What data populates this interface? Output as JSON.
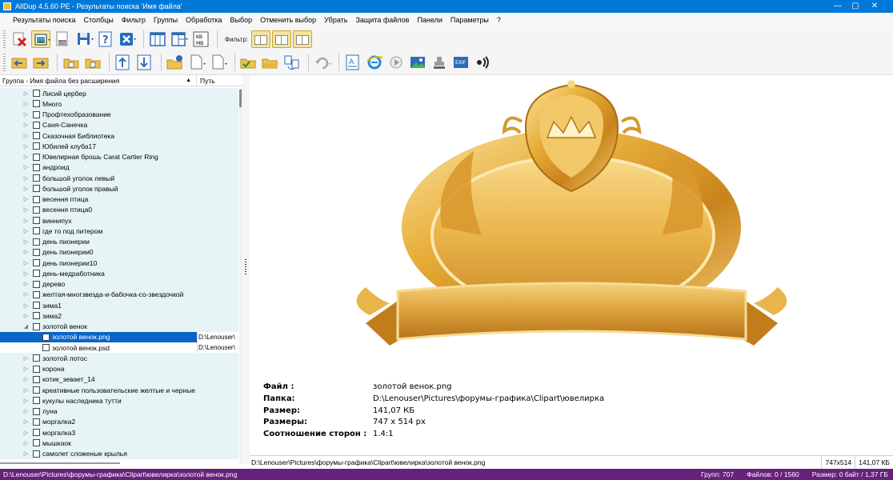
{
  "window": {
    "title": "AllDup 4.5.60 PE - Результаты поиска 'Имя файла'",
    "controls": [
      "—",
      "▢",
      "✕"
    ]
  },
  "menu": [
    "Результаты поиска",
    "Столбцы",
    "Фильтр",
    "Группы",
    "Обработка",
    "Выбор",
    "Отменить выбор",
    "Убрать",
    "Защита файлов",
    "Панели",
    "Параметры",
    "?"
  ],
  "toolbar": {
    "filter_label": "Фильтр:",
    "kbmb": "KB MB"
  },
  "left_pane": {
    "col_group": "Группа - Имя файла без расширения",
    "col_path": "Путь",
    "sort_icon": "▲",
    "rows": [
      {
        "label": "Лисий цербер",
        "type": "group",
        "expanded": false
      },
      {
        "label": "Много",
        "type": "group",
        "expanded": false
      },
      {
        "label": "Профтехобразование",
        "type": "group",
        "expanded": false
      },
      {
        "label": "Саня-Санечка",
        "type": "group",
        "expanded": false
      },
      {
        "label": "Сказочная Библиотека",
        "type": "group",
        "expanded": false
      },
      {
        "label": "Юбилей клуба17",
        "type": "group",
        "expanded": false
      },
      {
        "label": "Ювелирная брошь Carat Cartier Ring",
        "type": "group",
        "expanded": false
      },
      {
        "label": "андроид",
        "type": "group",
        "expanded": false
      },
      {
        "label": "большой уголок левый",
        "type": "group",
        "expanded": false
      },
      {
        "label": "большой уголок правый",
        "type": "group",
        "expanded": false
      },
      {
        "label": "весення птица",
        "type": "group",
        "expanded": false
      },
      {
        "label": "весення птица0",
        "type": "group",
        "expanded": false
      },
      {
        "label": "виннипух",
        "type": "group",
        "expanded": false
      },
      {
        "label": "где то под питером",
        "type": "group",
        "expanded": false
      },
      {
        "label": "день пионерии",
        "type": "group",
        "expanded": false
      },
      {
        "label": "день пионерии0",
        "type": "group",
        "expanded": false
      },
      {
        "label": "день пионерии10",
        "type": "group",
        "expanded": false
      },
      {
        "label": "день-медработника",
        "type": "group",
        "expanded": false
      },
      {
        "label": "дерево",
        "type": "group",
        "expanded": false
      },
      {
        "label": "желтая-многзвезда-и-бабочка-со-звездочкой",
        "type": "group",
        "expanded": false
      },
      {
        "label": "зима1",
        "type": "group",
        "expanded": false
      },
      {
        "label": "зима2",
        "type": "group",
        "expanded": false
      },
      {
        "label": "золотой венок",
        "type": "group",
        "expanded": true
      },
      {
        "label": "золотой венок.png",
        "type": "file",
        "path": "D:\\Lenouser\\",
        "selected": true
      },
      {
        "label": "золотой венок.psd",
        "type": "file",
        "path": "D:\\Lenouser\\",
        "selected": false
      },
      {
        "label": "золотой лотос",
        "type": "group",
        "expanded": false
      },
      {
        "label": "корона",
        "type": "group",
        "expanded": false
      },
      {
        "label": "котик_зевает_14",
        "type": "group",
        "expanded": false
      },
      {
        "label": "креативные пользовательские желтые и черные",
        "type": "group",
        "expanded": false
      },
      {
        "label": "кукулы наследника тутти",
        "type": "group",
        "expanded": false
      },
      {
        "label": "луна",
        "type": "group",
        "expanded": false
      },
      {
        "label": "моргалка2",
        "type": "group",
        "expanded": false
      },
      {
        "label": "моргалка3",
        "type": "group",
        "expanded": false
      },
      {
        "label": "мышкаок",
        "type": "group",
        "expanded": false
      },
      {
        "label": "самолет сложеные крылья",
        "type": "group",
        "expanded": false
      }
    ]
  },
  "preview": {
    "info": [
      {
        "key": "Файл :",
        "value": "золотой венок.png"
      },
      {
        "key": "Папка:",
        "value": "D:\\Lenouser\\Pictures\\форумы-графика\\Clipart\\ювелирка"
      },
      {
        "key": "Размер:",
        "value": "141,07 КБ"
      },
      {
        "key": "Размеры:",
        "value": "747 x 514 px"
      },
      {
        "key": "Соотношение сторон :",
        "value": "1.4:1"
      }
    ]
  },
  "pathbar": {
    "path": "D:\\Lenouser\\Pictures\\форумы-графика\\Clipart\\ювелирка\\золотой венок.png",
    "dims": "747x514",
    "size": "141,07 КБ"
  },
  "status": {
    "path": "D:\\Lenouser\\Pictures\\форумы-графика\\Clipart\\ювелирка\\золотой венок.png",
    "groups": "Групп: 707",
    "files": "Файлов: 0 / 1560",
    "size": "Размер: 0 байт / 1,37 ГБ"
  }
}
